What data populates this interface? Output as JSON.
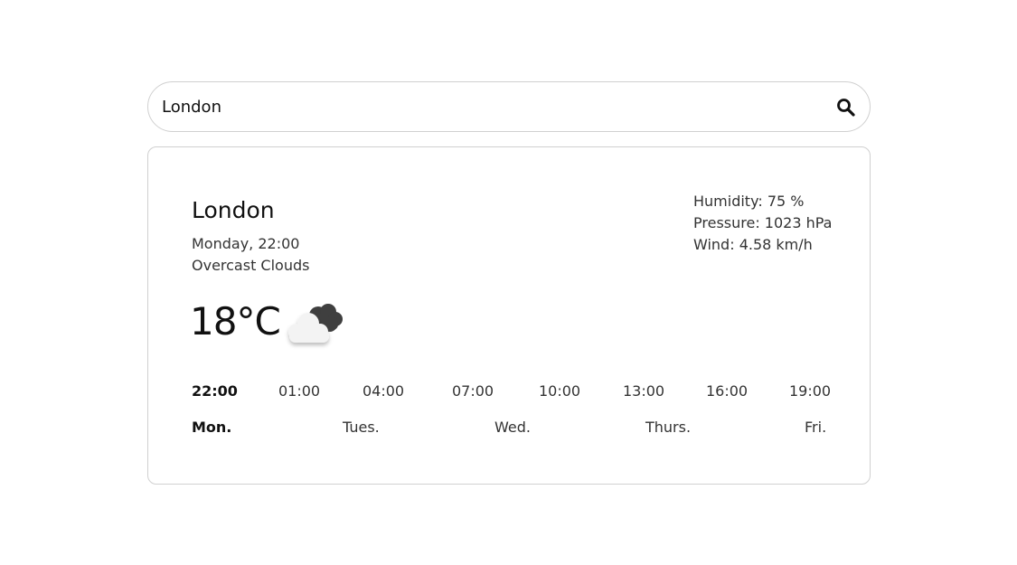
{
  "search": {
    "value": "London",
    "icon": "search-icon"
  },
  "current": {
    "city": "London",
    "datetime": "Monday, 22:00",
    "description": "Overcast Clouds",
    "temperature": "18°C",
    "icon": "overcast-clouds-icon"
  },
  "stats": {
    "humidity": "Humidity: 75 %",
    "pressure": "Pressure: 1023 hPa",
    "wind": "Wind: 4.58 km/h"
  },
  "hours": [
    "22:00",
    "01:00",
    "04:00",
    "07:00",
    "10:00",
    "13:00",
    "16:00",
    "19:00"
  ],
  "days": [
    "Mon.",
    "Tues.",
    "Wed.",
    "Thurs.",
    "Fri."
  ],
  "selected": {
    "hour": "22:00",
    "day": "Mon."
  }
}
